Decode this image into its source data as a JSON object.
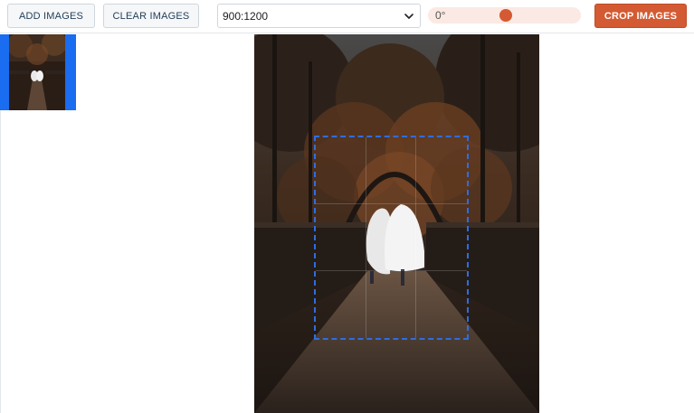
{
  "toolbar": {
    "add_label": "ADD IMAGES",
    "clear_label": "CLEAR IMAGES",
    "aspect_ratio_value": "900:1200",
    "rotation_label": "0°",
    "rotation_value_fraction": 0.51,
    "crop_label": "CROP IMAGES"
  },
  "colors": {
    "accent": "#d35a32",
    "thumbnail_selected": "#1a6cf0",
    "crop_outline": "#2f6de0"
  },
  "icons": {
    "select": "chevron-down-icon"
  }
}
